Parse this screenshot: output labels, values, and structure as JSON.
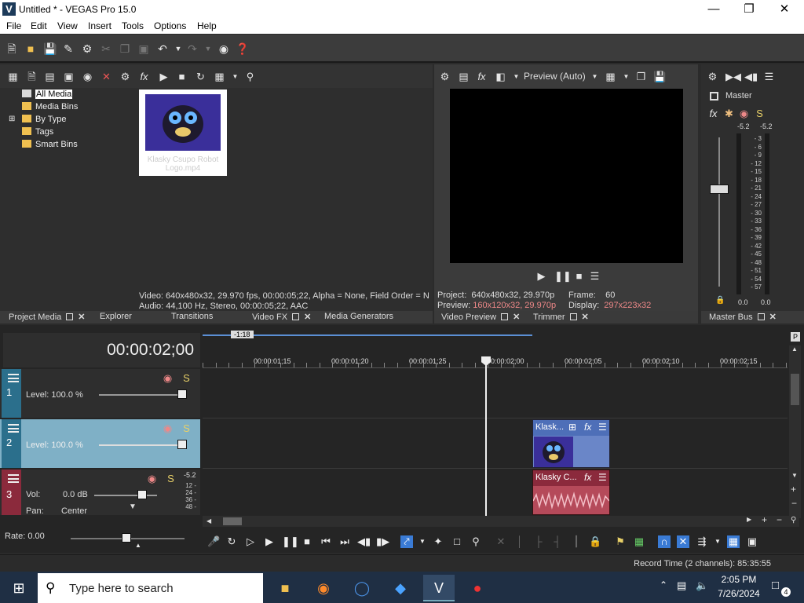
{
  "window": {
    "title": "Untitled * - VEGAS Pro 15.0",
    "logo": "V"
  },
  "menu": [
    "File",
    "Edit",
    "View",
    "Insert",
    "Tools",
    "Options",
    "Help"
  ],
  "project_media": {
    "tree": [
      "All Media",
      "Media Bins",
      "By Type",
      "Tags",
      "Smart Bins"
    ],
    "thumbnail_caption": "Klasky Csupo Robot Logo.mp4",
    "video_info": "Video: 640x480x32, 29.970 fps, 00:00:05;22, Alpha = None, Field Order = N",
    "audio_info": "Audio: 44,100 Hz, Stereo, 00:00:05;22, AAC"
  },
  "preview": {
    "mode": "Preview (Auto)",
    "project_label": "Project:",
    "project_value": "640x480x32, 29.970p",
    "preview_label": "Preview:",
    "preview_value": "160x120x32, 29.970p",
    "frame_label": "Frame:",
    "frame_value": "60",
    "display_label": "Display:",
    "display_value": "297x223x32"
  },
  "master": {
    "title": "Master",
    "peak_left": "-5.2",
    "peak_right": "-5.2",
    "scale": [
      "3",
      "6",
      "9",
      "12",
      "15",
      "18",
      "21",
      "24",
      "27",
      "30",
      "33",
      "36",
      "39",
      "42",
      "45",
      "48",
      "51",
      "54",
      "57"
    ],
    "bottom_left": "0.0",
    "bottom_right": "0.0"
  },
  "tabs_left": [
    "Project Media",
    "Explorer",
    "Transitions",
    "Video FX",
    "Media Generators"
  ],
  "tabs_mid": [
    "Video Preview",
    "Trimmer"
  ],
  "tabs_right": [
    "Master Bus"
  ],
  "timeline": {
    "timecode": "00:00:02;00",
    "loop_marker": "-1:18",
    "ruler": [
      "00:00:01;15",
      "00:00:01;20",
      "00:00:01;25",
      "00:00:02;00",
      "00:00:02;05",
      "00:00:02;10",
      "00:00:02;15"
    ],
    "tracks": [
      {
        "number": "1",
        "level": "Level: 100.0 %"
      },
      {
        "number": "2",
        "level": "Level: 100.0 %"
      },
      {
        "number": "3",
        "vol_label": "Vol:",
        "vol_value": "0.0 dB",
        "pan_label": "Pan:",
        "pan_value": "Center",
        "meter_top": "-5.2",
        "meter_scale": [
          "12",
          "24",
          "36",
          "48"
        ]
      }
    ],
    "video_event_label": "Klask...",
    "audio_event_label": "Klasky C...",
    "rate": "Rate: 0.00"
  },
  "status": {
    "record_time": "Record Time (2 channels): 85:35:55"
  },
  "taskbar": {
    "search_placeholder": "Type here to search",
    "time": "2:05 PM",
    "date": "7/26/2024",
    "notifications": "4"
  },
  "colors": {
    "track1": "#2b6f8c",
    "track2": "#7fb0c6",
    "track3": "#8b2a3c",
    "video_event": "#6a86c8",
    "audio_event": "#b54a5a"
  }
}
